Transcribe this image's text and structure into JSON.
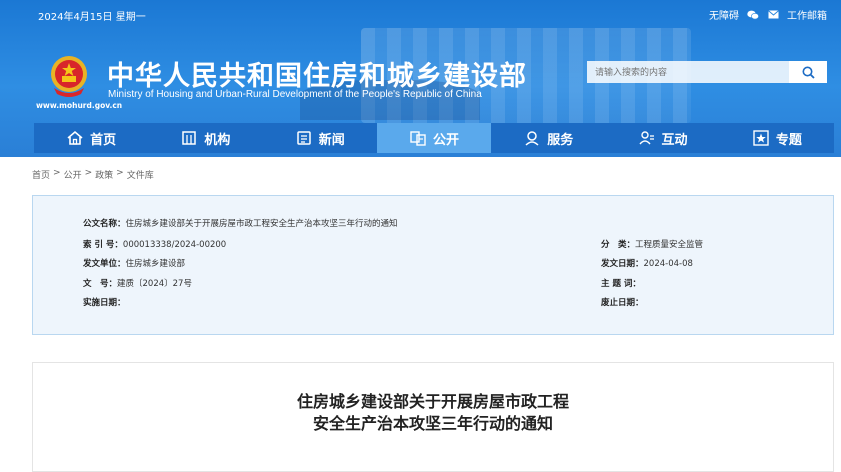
{
  "header": {
    "date": "2024年4月15日 星期一",
    "accessibility": "无障碍",
    "work_mail": "工作邮箱",
    "title_cn": "中华人民共和国住房和城乡建设部",
    "title_en": "Ministry of Housing and Urban-Rural Development of the People's Republic of China",
    "url": "www.mohurd.gov.cn",
    "search_placeholder": "请输入搜索的内容"
  },
  "nav": [
    {
      "label": "首页",
      "icon": "home-icon"
    },
    {
      "label": "机构",
      "icon": "building-icon"
    },
    {
      "label": "新闻",
      "icon": "news-icon"
    },
    {
      "label": "公开",
      "icon": "document-icon"
    },
    {
      "label": "服务",
      "icon": "service-icon"
    },
    {
      "label": "互动",
      "icon": "interaction-icon"
    },
    {
      "label": "专题",
      "icon": "star-icon"
    }
  ],
  "breadcrumb": [
    "首页",
    "公开",
    "政策",
    "文件库"
  ],
  "info": {
    "doc_name_label": "公文名称：",
    "doc_name": "住房城乡建设部关于开展房屋市政工程安全生产治本攻坚三年行动的通知",
    "index_label": "索 引 号：",
    "index": "000013338/2024-00200",
    "category_label": "分　类：",
    "category": "工程质量安全监管",
    "issuer_label": "发文单位：",
    "issuer": "住房城乡建设部",
    "date_label": "发文日期：",
    "date": "2024-04-08",
    "number_label": "文　号：",
    "number": "建质〔2024〕27号",
    "keywords_label": "主 题 词：",
    "keywords": "",
    "effective_label": "实施日期：",
    "effective": "",
    "repeal_label": "废止日期：",
    "repeal": ""
  },
  "article": {
    "title_line1": "住房城乡建设部关于开展房屋市政工程",
    "title_line2": "安全生产治本攻坚三年行动的通知"
  },
  "colors": {
    "header_blue": "#2a87dd",
    "nav_blue": "#1c6bc4",
    "nav_active": "#5aa9ec",
    "info_bg": "#eef5fc"
  }
}
